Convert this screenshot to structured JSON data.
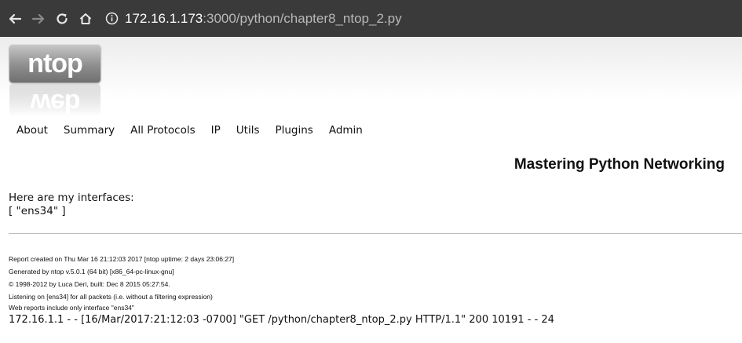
{
  "browser": {
    "url_host": "172.16.1.173",
    "url_rest": ":3000/python/chapter8_ntop_2.py"
  },
  "logo": {
    "text": "ntop",
    "reflection_text": "web"
  },
  "menu": {
    "items": [
      {
        "label": "About"
      },
      {
        "label": "Summary"
      },
      {
        "label": "All Protocols"
      },
      {
        "label": "IP"
      },
      {
        "label": "Utils"
      },
      {
        "label": "Plugins"
      },
      {
        "label": "Admin"
      }
    ]
  },
  "page": {
    "heading": "Mastering Python Networking",
    "intro_line1": "Here are my interfaces:",
    "intro_line2": "[ \"ens34\" ]"
  },
  "footer": {
    "line1": "Report created on Thu Mar 16 21:12:03 2017 [ntop uptime: 2 days 23:06:27]",
    "line2": "Generated by ntop v.5.0.1 (64 bit) [x86_64-pc-linux-gnu]",
    "line3": "© 1998-2012 by Luca Deri, built: Dec 8 2015 05:27:54.",
    "line4": "Listening on [ens34] for all packets (i.e. without a filtering expression)",
    "line5": "Web reports include only interface \"ens34\""
  },
  "log": {
    "line": "172.16.1.1 - - [16/Mar/2017:21:12:03 -0700] \"GET /python/chapter8_ntop_2.py HTTP/1.1\" 200 10191 - - 24"
  }
}
